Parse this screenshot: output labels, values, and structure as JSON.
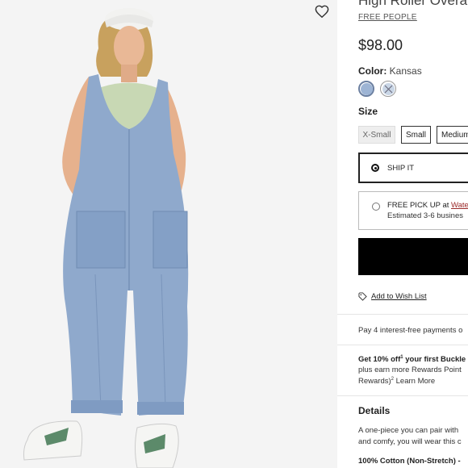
{
  "product": {
    "title": "High Roller Overalls",
    "brand": "FREE PEOPLE",
    "price": "$98.00",
    "color_label": "Color:",
    "color_value": "Kansas",
    "swatches": [
      {
        "name": "kansas",
        "color": "#9db4d4",
        "selected": true
      },
      {
        "name": "alternate",
        "color": "#c9d6e6",
        "selected": false
      }
    ],
    "size_label": "Size",
    "sizes": [
      "X-Small",
      "Small",
      "Medium"
    ]
  },
  "fulfillment": {
    "ship_label": "SHIP IT",
    "pickup_prefix": "FREE PICK UP at ",
    "pickup_store": "Wate",
    "pickup_estimate": "Estimated 3-6 busines"
  },
  "wishlist": {
    "label": "Add to Wish List"
  },
  "payments": {
    "text": "Pay 4 interest-free payments o"
  },
  "promo": {
    "line1": "Get 10% off",
    "line1_sup": "1",
    "line1_rest": " your first Buckle",
    "line2": "plus earn more Rewards Point",
    "line3": "Rewards)",
    "line3_sup": "2",
    "line3_rest": " Learn More"
  },
  "details": {
    "heading": "Details",
    "line1": "A one-piece you can pair with",
    "line2": "and comfy, you will wear this c",
    "line3": "100% Cotton (Non-Stretch) - "
  },
  "colors": {
    "accent_red": "#9b2a2a",
    "button_black": "#000000",
    "denim": "#8fa9cc"
  }
}
